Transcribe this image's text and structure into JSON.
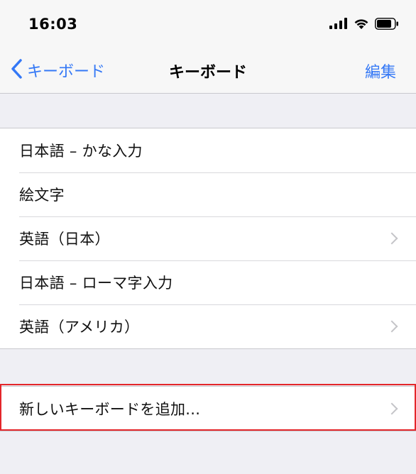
{
  "status_bar": {
    "time": "16:03",
    "icons": [
      "cellular-signal-icon",
      "wifi-icon",
      "battery-icon"
    ]
  },
  "nav": {
    "back_label": "キーボード",
    "title": "キーボード",
    "edit_label": "編集"
  },
  "keyboards": [
    {
      "label": "日本語 – かな入力",
      "has_chevron": false
    },
    {
      "label": "絵文字",
      "has_chevron": false
    },
    {
      "label": "英語（日本）",
      "has_chevron": true
    },
    {
      "label": "日本語 – ローマ字入力",
      "has_chevron": false
    },
    {
      "label": "英語（アメリカ）",
      "has_chevron": true
    }
  ],
  "add_keyboard": {
    "label": "新しいキーボードを追加...",
    "highlighted": true
  },
  "colors": {
    "accent": "#3478f6",
    "background": "#efeff4",
    "highlight": "#e3262a"
  }
}
